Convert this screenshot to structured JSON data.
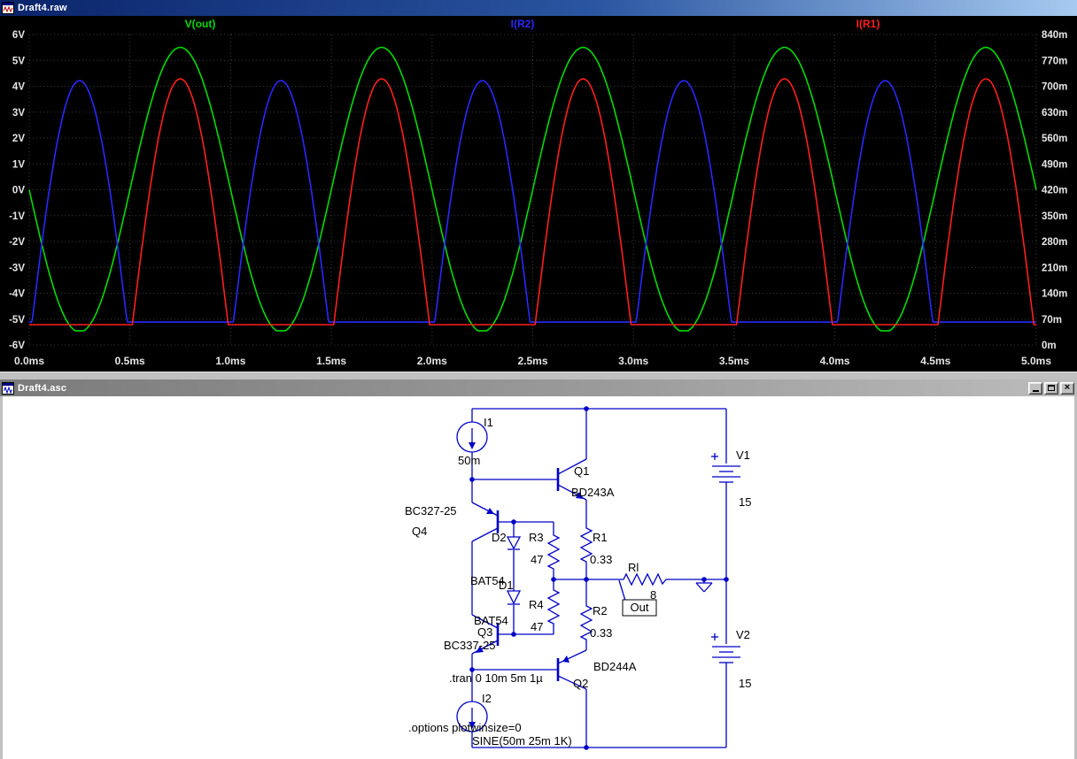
{
  "plot_window": {
    "title": "Draft4.raw"
  },
  "schematic_window": {
    "title": "Draft4.asc",
    "buttons": {
      "close_glyph": "×"
    }
  },
  "chart_data": {
    "type": "line",
    "background": "#000000",
    "x_axis": {
      "unit": "ms",
      "min": 0,
      "max": 5,
      "tick_labels": [
        "0.0ms",
        "0.5ms",
        "1.0ms",
        "1.5ms",
        "2.0ms",
        "2.5ms",
        "3.0ms",
        "3.5ms",
        "4.0ms",
        "4.5ms",
        "5.0ms"
      ]
    },
    "y_axis_left": {
      "unit": "V",
      "min": -6,
      "max": 6,
      "tick_labels": [
        "6V",
        "5V",
        "4V",
        "3V",
        "2V",
        "1V",
        "0V",
        "-1V",
        "-2V",
        "-3V",
        "-4V",
        "-5V",
        "-6V"
      ]
    },
    "y_axis_right": {
      "unit": "m",
      "min": 0,
      "max": 840,
      "tick_labels": [
        "840m",
        "770m",
        "700m",
        "630m",
        "560m",
        "490m",
        "420m",
        "350m",
        "280m",
        "210m",
        "140m",
        "70m",
        "0m"
      ]
    },
    "grid": {
      "show": true,
      "color": "#3c3c3c"
    },
    "series": [
      {
        "name": "V(out)",
        "color": "#00dc00",
        "axis": "left",
        "waveform": {
          "kind": "sine",
          "amp": 5.5,
          "sign": -1,
          "freq_per_ms": 1,
          "clip_min": -5.45
        },
        "peaks_at_ms": [
          0.75,
          1.75,
          2.75,
          3.75,
          4.75
        ]
      },
      {
        "name": "I(R2)",
        "color": "#2828ff",
        "axis": "right",
        "waveform": {
          "kind": "rectified",
          "amp": 715,
          "sign": 1,
          "freq_per_ms": 1,
          "floor": 62
        },
        "peaks_at_ms": [
          0.25,
          1.25,
          2.25,
          3.25,
          4.25
        ]
      },
      {
        "name": "I(R1)",
        "color": "#ff1e1e",
        "axis": "right",
        "waveform": {
          "kind": "rectified",
          "amp": 720,
          "sign": -1,
          "freq_per_ms": 1,
          "floor": 55
        },
        "peaks_at_ms": [
          0.75,
          1.75,
          2.75,
          3.75,
          4.75
        ]
      }
    ]
  },
  "schematic": {
    "components": {
      "I1": {
        "name": "I1",
        "value": "50m"
      },
      "I2": {
        "name": "I2",
        "value": "SINE(50m 25m 1K)"
      },
      "Q1": {
        "name": "Q1",
        "value": "BD243A"
      },
      "Q2": {
        "name": "Q2",
        "value": "BD244A"
      },
      "Q3": {
        "name": "Q3",
        "value": "BC337-25"
      },
      "Q4": {
        "name": "Q4",
        "value": "BC327-25"
      },
      "D1": {
        "name": "D1",
        "value": "BAT54"
      },
      "D2": {
        "name": "D2",
        "value": "BAT54"
      },
      "R1": {
        "name": "R1",
        "value": "0.33"
      },
      "R2": {
        "name": "R2",
        "value": "0.33"
      },
      "R3": {
        "name": "R3",
        "value": "47"
      },
      "R4": {
        "name": "R4",
        "value": "47"
      },
      "Rl": {
        "name": "Rl",
        "value": "8"
      },
      "V1": {
        "name": "V1",
        "value": "15"
      },
      "V2": {
        "name": "V2",
        "value": "15"
      }
    },
    "net_labels": {
      "out": "Out"
    },
    "directives": {
      "tran": ".tran 0 10m 5m 1µ",
      "options": ".options plotwinsize=0"
    },
    "colors": {
      "wire": "#0000c8",
      "text": "#000000"
    }
  }
}
